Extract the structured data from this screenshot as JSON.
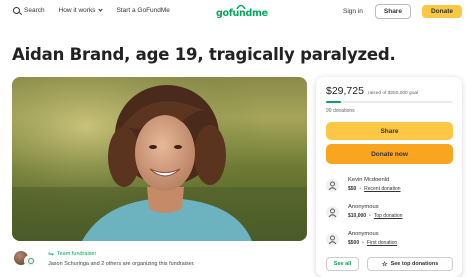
{
  "header": {
    "search_label": "Search",
    "how_it_works_label": "How it works",
    "start_label": "Start a GoFundMe",
    "logo_text": "gofundme",
    "signin_label": "Sign in",
    "share_label": "Share",
    "donate_label": "Donate",
    "icons": [
      "search-icon",
      "chevron-down-icon"
    ]
  },
  "campaign": {
    "title": "Aidan Brand, age 19, tragically paralyzed."
  },
  "organizer": {
    "team_label": "Team fundraiser",
    "text": "Jason Schuringa and 2 others are organizing this fundraiser."
  },
  "card": {
    "amount_raised": "$29,725",
    "goal_text": "raised of $250,000 goal",
    "progress_fraction": 0.119,
    "donations_count": "99 donations",
    "share_label": "Share",
    "donate_label": "Donate now",
    "donors": [
      {
        "name": "Kevin Mcdoenld",
        "amount": "$50",
        "tag": "Recent donation"
      },
      {
        "name": "Anonymous",
        "amount": "$10,000",
        "tag": "Top donation"
      },
      {
        "name": "Anonymous",
        "amount": "$500",
        "tag": "First donation"
      }
    ],
    "see_all_label": "See all",
    "see_top_label": "See top donations"
  },
  "colors": {
    "brand_green": "#02a95c",
    "donate_yellow": "#fbc745",
    "donate_orange": "#f9a51f"
  }
}
